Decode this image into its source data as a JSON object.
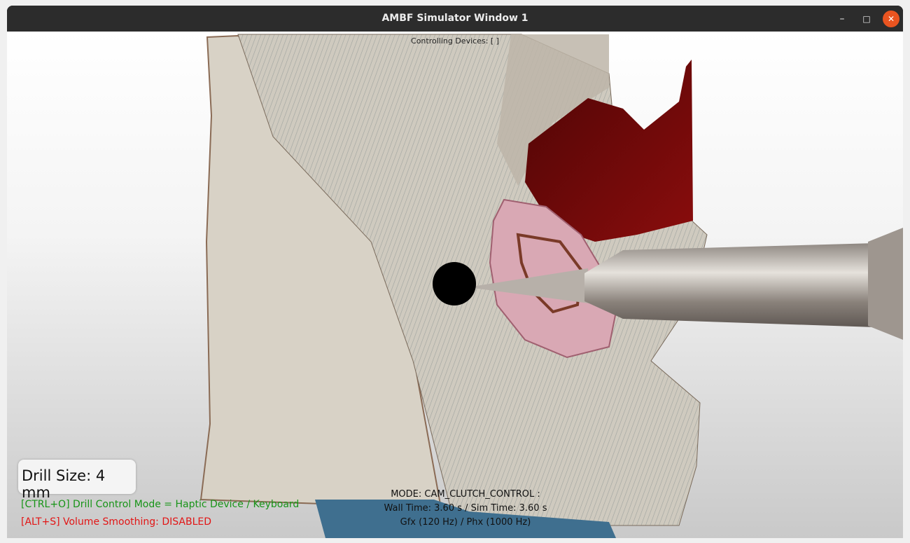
{
  "window": {
    "title": "AMBF Simulator Window 1",
    "controls": {
      "minimize": "–",
      "maximize": "□",
      "close": "✕"
    }
  },
  "hud": {
    "controlling_devices": "Controlling Devices: [ ]",
    "drill_size": "Drill Size: 4 mm",
    "drill_control_mode": "[CTRL+O] Drill Control Mode = Haptic Device / Keyboard",
    "volume_smoothing": "[ALT+S] Volume Smoothing: DISABLED",
    "mode": "MODE: CAM_CLUTCH_CONTROL :",
    "time": "Wall Time: 3.60 s / Sim Time: 3.60 s",
    "rates": "Gfx (120 Hz) / Phx (1000 Hz)"
  },
  "colors": {
    "titlebar": "#2c2c2c",
    "close_button": "#e95420",
    "bone": "#d8d2c6",
    "dark_red_structure": "#6d0808",
    "pink_structure": "#d9a8b4",
    "blue_structure": "#3f6f8f",
    "drill_tip": "#000000",
    "status_green": "#179417",
    "status_red": "#e21515"
  },
  "icons": {
    "minimize": "minimize-icon",
    "maximize": "maximize-icon",
    "close": "close-icon"
  }
}
